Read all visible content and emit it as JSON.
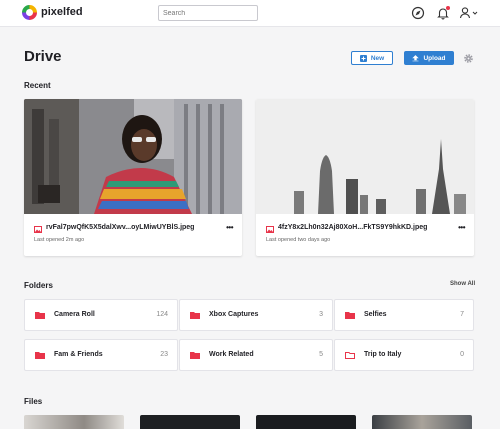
{
  "app": {
    "brand": "pixelfed"
  },
  "search": {
    "placeholder": "Search"
  },
  "header": {
    "title": "Drive",
    "new_label": "New",
    "upload_label": "Upload"
  },
  "recent": {
    "title": "Recent",
    "items": [
      {
        "name": "rvFal7pwQfK5X5dalXwv...oyLMiwUYBlS.jpeg",
        "meta": "Last opened 2m ago",
        "menu": "•••"
      },
      {
        "name": "4fzY8x2Lh0n32Aj80XoH...FkTS9Y9hkKD.jpeg",
        "meta": "Last opened two days ago",
        "menu": "•••"
      }
    ]
  },
  "folders": {
    "title": "Folders",
    "show_all": "Show All",
    "items": [
      {
        "name": "Camera Roll",
        "count": "124"
      },
      {
        "name": "Xbox Captures",
        "count": "3"
      },
      {
        "name": "Selfies",
        "count": "7"
      },
      {
        "name": "Fam & Friends",
        "count": "23"
      },
      {
        "name": "Work Related",
        "count": "5"
      },
      {
        "name": "Trip to Italy",
        "count": "0"
      }
    ]
  },
  "files": {
    "title": "Files"
  },
  "colors": {
    "accent": "#2f7fd1",
    "folder": "#e8344a",
    "notification": "#e8344a"
  }
}
